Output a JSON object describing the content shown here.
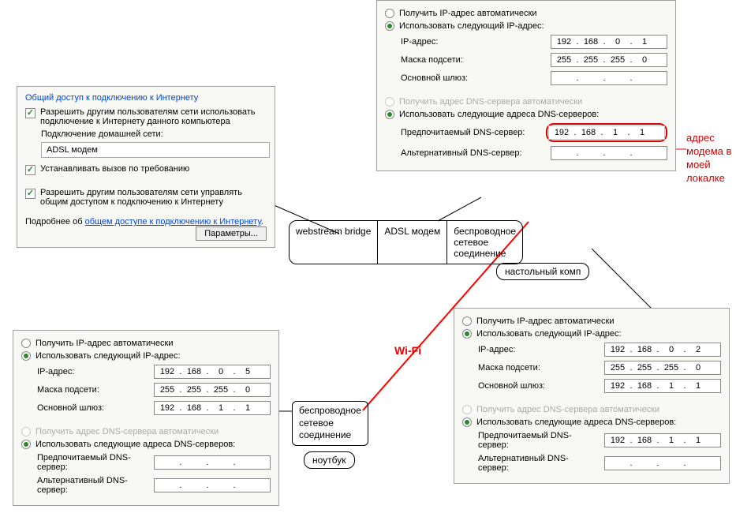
{
  "sharing_panel": {
    "header": "Общий доступ к подключению к Интернету",
    "chk1": "Разрешить другим пользователям сети использовать подключение к Интернету данного компьютера",
    "home_label": "Подключение домашней сети:",
    "home_value": "ADSL модем",
    "chk2": "Устанавливать вызов по требованию",
    "chk3": "Разрешить другим пользователям сети управлять общим доступом к подключению к Интернету",
    "more_prefix": "Подробнее об ",
    "more_link": "общем доступе к подключению к Интернету",
    "params_btn": "Параметры..."
  },
  "net_labels": {
    "auto_ip": "Получить IP-адрес автоматически",
    "use_ip": "Использовать следующий IP-адрес:",
    "ip": "IP-адрес:",
    "mask": "Маска подсети:",
    "gw": "Основной шлюз:",
    "auto_dns": "Получить адрес DNS-сервера автоматически",
    "use_dns": "Использовать следующие адреса DNS-серверов:",
    "dns1": "Предпочитаемый DNS-сервер:",
    "dns2": "Альтернативный DNS-сервер:"
  },
  "top_right": {
    "ip": [
      "192",
      "168",
      "0",
      "1"
    ],
    "mask": [
      "255",
      "255",
      "255",
      "0"
    ],
    "gw": [
      "",
      "",
      "",
      ""
    ],
    "dns1": [
      "192",
      "168",
      "1",
      "1"
    ],
    "dns2": [
      "",
      "",
      "",
      ""
    ]
  },
  "bottom_left": {
    "ip": [
      "192",
      "168",
      "0",
      "5"
    ],
    "mask": [
      "255",
      "255",
      "255",
      "0"
    ],
    "gw": [
      "192",
      "168",
      "1",
      "1"
    ],
    "dns1": [
      "",
      "",
      "",
      ""
    ],
    "dns2": [
      "",
      "",
      "",
      ""
    ]
  },
  "bottom_right": {
    "ip": [
      "192",
      "168",
      "0",
      "2"
    ],
    "mask": [
      "255",
      "255",
      "255",
      "0"
    ],
    "gw": [
      "192",
      "168",
      "1",
      "1"
    ],
    "dns1": [
      "192",
      "168",
      "1",
      "1"
    ],
    "dns2": [
      "",
      "",
      "",
      ""
    ]
  },
  "devices": {
    "cell1": "webstream bridge",
    "cell2": "ADSL модем",
    "cell3": "беспроводное\nсетевое\nсоединение",
    "desktop": "настольный комп",
    "laptop_box": "беспроводное\nсетевое\nсоединение",
    "laptop": "ноутбук"
  },
  "wifi_label": "Wi-Fi",
  "annotation": "адрес\nмодема в\nмоей\nлокалке"
}
